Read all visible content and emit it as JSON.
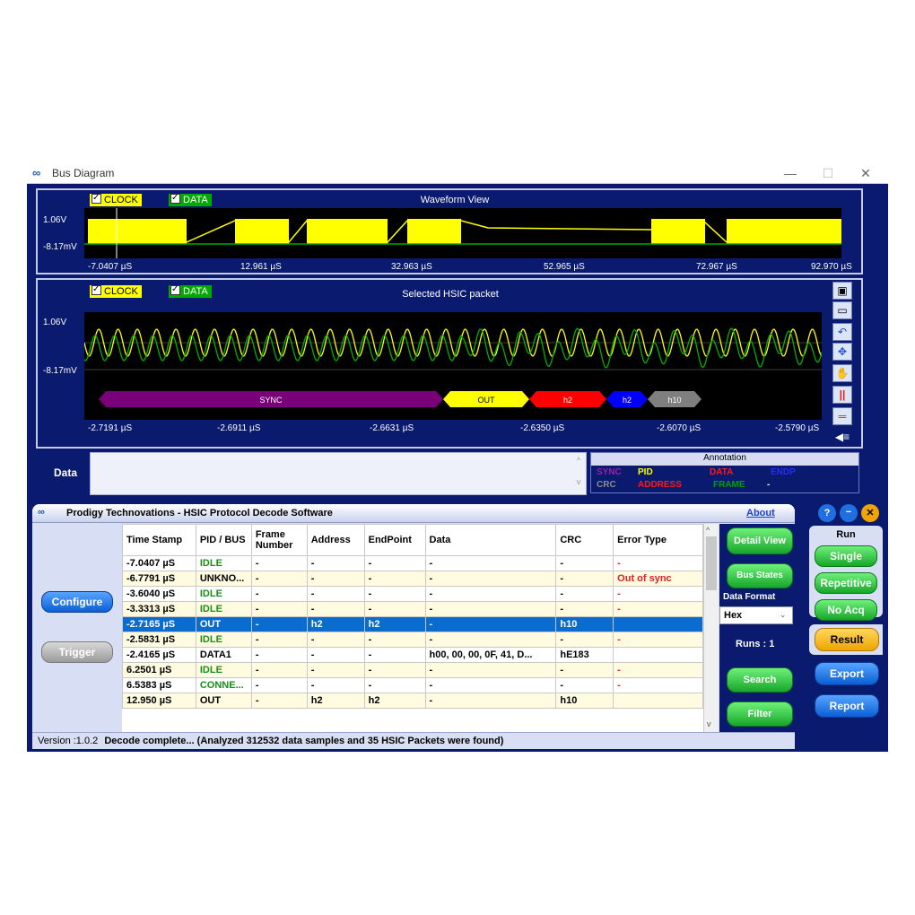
{
  "window": {
    "title": "Bus Diagram",
    "minimize": "—",
    "maximize": "☐",
    "close": "✕"
  },
  "waveform": {
    "title": "Waveform View",
    "clock_label": "CLOCK",
    "data_label": "DATA",
    "v_high": "1.06V",
    "v_low": "-8.17mV",
    "ticks": [
      "-7.0407 µS",
      "12.961 µS",
      "32.963 µS",
      "52.965 µS",
      "72.967 µS",
      "92.970 µS"
    ]
  },
  "packet": {
    "title": "Selected HSIC packet",
    "clock_label": "CLOCK",
    "data_label": "DATA",
    "v_high": "1.06V",
    "v_low": "-8.17mV",
    "ticks": [
      "-2.7191 µS",
      "-2.6911 µS",
      "-2.6631 µS",
      "-2.6350 µS",
      "-2.6070 µS",
      "-2.5790 µS"
    ],
    "segments": [
      {
        "label": "SYNC",
        "color": "#7a007a",
        "text_color": "#ffffff"
      },
      {
        "label": "OUT",
        "color": "#ffff00",
        "text_color": "#000000"
      },
      {
        "label": "h2",
        "color": "#ff0000",
        "text_color": "#ffffff"
      },
      {
        "label": "h2",
        "color": "#0000ff",
        "text_color": "#ffffff"
      },
      {
        "label": "h10",
        "color": "#7f7f7f",
        "text_color": "#ffffff"
      }
    ]
  },
  "data_section": {
    "label": "Data"
  },
  "annotation": {
    "header": "Annotation",
    "items": [
      {
        "label": "SYNC",
        "color": "#a020a0"
      },
      {
        "label": "PID",
        "color": "#ffff00"
      },
      {
        "label": "DATA",
        "color": "#ff1a1a"
      },
      {
        "label": "ENDP",
        "color": "#2a2aff"
      },
      {
        "label": "CRC",
        "color": "#8c8c8c"
      },
      {
        "label": "ADDRESS",
        "color": "#ff1a1a"
      },
      {
        "label": "FRAME",
        "color": "#00a000"
      },
      {
        "label": "-",
        "color": "#ffffff"
      }
    ]
  },
  "decoder": {
    "title": "Prodigy Technovations  - HSIC Protocol Decode Software",
    "about": "About",
    "configure": "Configure",
    "trigger": "Trigger",
    "columns": [
      "Time Stamp",
      "PID / BUS",
      "Frame Number",
      "Address",
      "EndPoint",
      "Data",
      "CRC",
      "Error Type"
    ],
    "rows": [
      {
        "ts": "-7.0407 µS",
        "pid": "IDLE",
        "pid_color": "green",
        "frame": "-",
        "addr": "-",
        "ep": "-",
        "data": "-",
        "crc": "-",
        "err": "-",
        "err_color": "red"
      },
      {
        "ts": "-6.7791 µS",
        "pid": "UNKNO...",
        "pid_color": "black",
        "frame": "-",
        "addr": "-",
        "ep": "-",
        "data": "-",
        "crc": "-",
        "err": "Out of sync",
        "err_color": "red"
      },
      {
        "ts": "-3.6040 µS",
        "pid": "IDLE",
        "pid_color": "green",
        "frame": "-",
        "addr": "-",
        "ep": "-",
        "data": "-",
        "crc": "-",
        "err": "-",
        "err_color": "red"
      },
      {
        "ts": "-3.3313 µS",
        "pid": "IDLE",
        "pid_color": "green",
        "frame": "-",
        "addr": "-",
        "ep": "-",
        "data": "-",
        "crc": "-",
        "err": "-",
        "err_color": "red"
      },
      {
        "ts": "-2.7165 µS",
        "pid": "OUT",
        "pid_color": "white",
        "frame": "-",
        "addr": "h2",
        "ep": "h2",
        "data": "-",
        "crc": "h10",
        "err": "",
        "err_color": "white",
        "selected": true
      },
      {
        "ts": "-2.5831 µS",
        "pid": "IDLE",
        "pid_color": "green",
        "frame": "-",
        "addr": "-",
        "ep": "-",
        "data": "-",
        "crc": "-",
        "err": "-",
        "err_color": "red"
      },
      {
        "ts": "-2.4165 µS",
        "pid": "DATA1",
        "pid_color": "black",
        "frame": "-",
        "addr": "-",
        "ep": "-",
        "data": "h00, 00, 00, 0F, 41, D...",
        "crc": "hE183",
        "err": "",
        "err_color": "black"
      },
      {
        "ts": "6.2501 µS",
        "pid": "IDLE",
        "pid_color": "green",
        "frame": "-",
        "addr": "-",
        "ep": "-",
        "data": "-",
        "crc": "-",
        "err": "-",
        "err_color": "red"
      },
      {
        "ts": "6.5383 µS",
        "pid": "CONNE...",
        "pid_color": "green",
        "frame": "-",
        "addr": "-",
        "ep": "-",
        "data": "-",
        "crc": "-",
        "err": "-",
        "err_color": "red"
      },
      {
        "ts": "12.950 µS",
        "pid": "OUT",
        "pid_color": "black",
        "frame": "-",
        "addr": "h2",
        "ep": "h2",
        "data": "-",
        "crc": "h10",
        "err": "",
        "err_color": "black"
      }
    ],
    "detail_view": "Detail View",
    "bus_states": "Bus States",
    "data_format_label": "Data Format",
    "data_format_value": "Hex",
    "runs_label": "Runs :",
    "runs_value": "1",
    "search": "Search",
    "filter": "Filter"
  },
  "run_panel": {
    "label": "Run",
    "single": "Single",
    "repetitive": "Repetitive",
    "no_acq": "No Acq",
    "result": "Result",
    "export": "Export",
    "report": "Report"
  },
  "status": {
    "version": "Version :1.0.2",
    "message": "Decode complete... (Analyzed 312532 data samples and 35 HSIC Packets were found)"
  }
}
